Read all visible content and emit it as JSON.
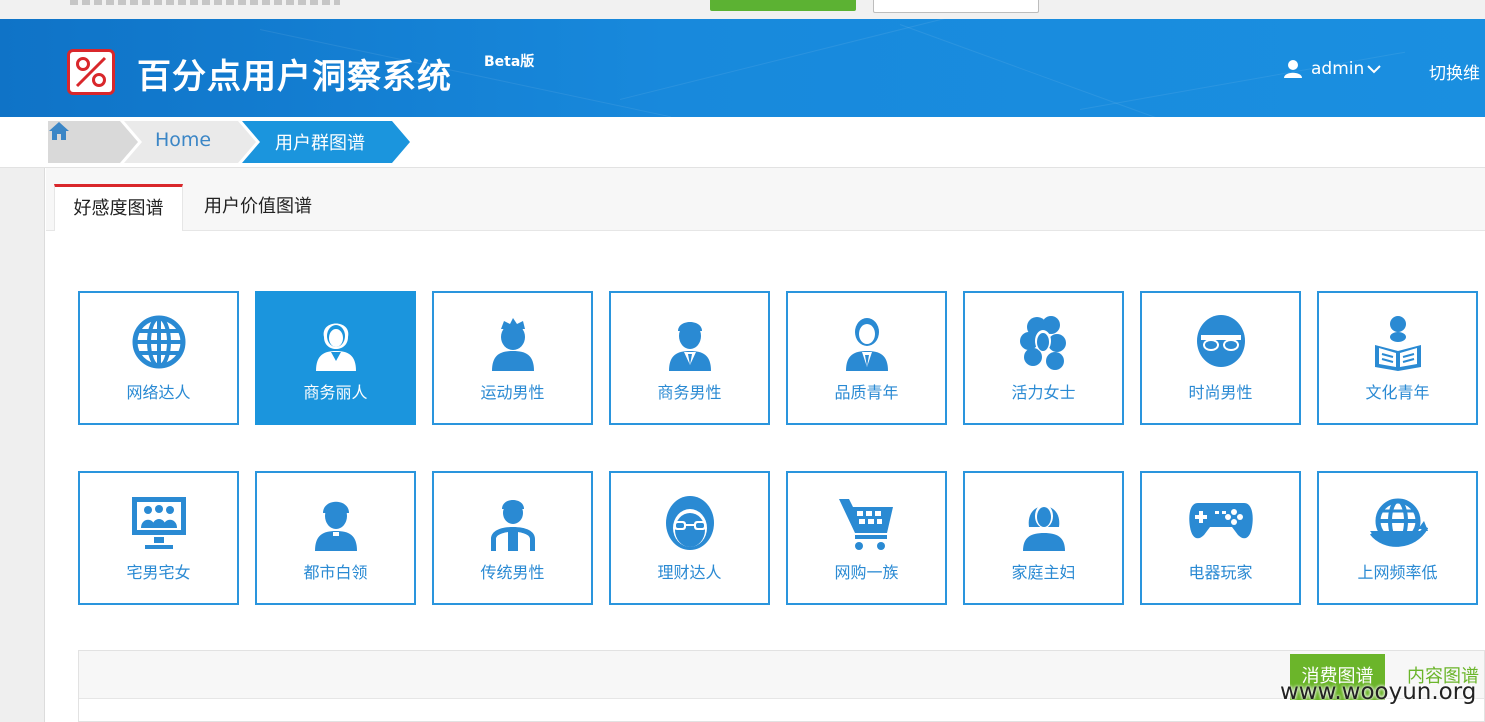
{
  "header": {
    "title": "百分点用户洞察系统",
    "beta": "Beta版",
    "user": "admin",
    "switch_label": "切换维"
  },
  "breadcrumb": {
    "home": "Home",
    "current": "用户群图谱"
  },
  "tabs": [
    {
      "label": "好感度图谱",
      "active": true
    },
    {
      "label": "用户价值图谱",
      "active": false
    }
  ],
  "tiles": [
    {
      "label": "网络达人",
      "icon": "globe-icon",
      "active": false
    },
    {
      "label": "商务丽人",
      "icon": "businesswoman-icon",
      "active": true
    },
    {
      "label": "运动男性",
      "icon": "sporty-man-icon",
      "active": false
    },
    {
      "label": "商务男性",
      "icon": "businessman-icon",
      "active": false
    },
    {
      "label": "品质青年",
      "icon": "quality-youth-icon",
      "active": false
    },
    {
      "label": "活力女士",
      "icon": "curly-woman-icon",
      "active": false
    },
    {
      "label": "时尚男性",
      "icon": "sunglasses-man-icon",
      "active": false
    },
    {
      "label": "文化青年",
      "icon": "reader-icon",
      "active": false
    },
    {
      "label": "宅男宅女",
      "icon": "monitor-people-icon",
      "active": false
    },
    {
      "label": "都市白领",
      "icon": "office-worker-icon",
      "active": false
    },
    {
      "label": "传统男性",
      "icon": "tie-man-icon",
      "active": false
    },
    {
      "label": "理财达人",
      "icon": "glasses-face-icon",
      "active": false
    },
    {
      "label": "网购一族",
      "icon": "shopping-cart-icon",
      "active": false
    },
    {
      "label": "家庭主妇",
      "icon": "housewife-icon",
      "active": false
    },
    {
      "label": "电器玩家",
      "icon": "gamepad-icon",
      "active": false
    },
    {
      "label": "上网频率低",
      "icon": "globe-arrow-icon",
      "active": false
    }
  ],
  "panel": {
    "active_button": "消费图谱",
    "link_button": "内容图谱"
  },
  "watermark": "www.wooyun.org",
  "colors": {
    "header_blue": "#1889dc",
    "accent_red": "#d9272b",
    "tile_blue": "#2a95dd",
    "green": "#6bb52a"
  }
}
